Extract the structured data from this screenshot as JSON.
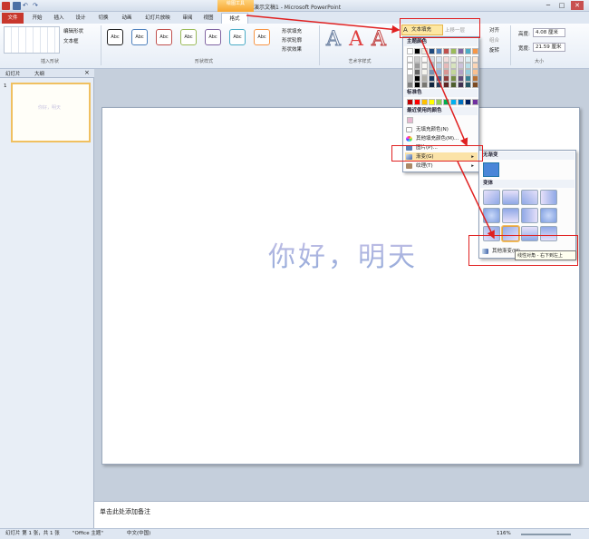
{
  "window": {
    "title": "演示文稿1 - Microsoft PowerPoint",
    "context_tab_group": "绘图工具",
    "min": "─",
    "max": "□",
    "close": "✕"
  },
  "tabs": [
    "文件",
    "开始",
    "插入",
    "设计",
    "切换",
    "动画",
    "幻灯片放映",
    "审阅",
    "视图",
    "格式"
  ],
  "ribbon": {
    "edit_shape": "编辑形状",
    "text_box": "文本框",
    "insert_shapes_group": "插入形状",
    "shape_styles_group": "形状样式",
    "shape_fill": "形状填充",
    "shape_outline": "形状轮廓",
    "shape_effects": "形状效果",
    "wordart_group": "艺术字样式",
    "text_fill": "文本填充",
    "bring_forward": "上移一层",
    "align": "对齐",
    "group": "组合",
    "rotate": "旋转",
    "height_label": "高度:",
    "height_value": "4.08 厘米",
    "width_label": "宽度:",
    "width_value": "21.59 厘米",
    "size_group": "大小",
    "abc": "Abc",
    "wordart_a": "A"
  },
  "left_panel": {
    "tab_slides": "幻灯片",
    "tab_outline": "大纲",
    "slide_number": "1",
    "thumb_text": "你好，明天"
  },
  "slide": {
    "text": "你好，明天"
  },
  "notes": {
    "placeholder": "单击此处添加备注"
  },
  "status": {
    "slide_info": "幻灯片 第 1 张，共 1 张",
    "theme": "\"Office 主题\"",
    "language": "中文(中国)",
    "zoom": "116%"
  },
  "fill_menu": {
    "theme_colors": "主题颜色",
    "standard_colors": "标准色",
    "recent_colors": "最近使用的颜色",
    "no_fill": "无填充颜色(N)",
    "more_colors": "其他填充颜色(M)...",
    "picture": "图片(P)...",
    "gradient": "渐变(G)",
    "texture": "纹理(T)"
  },
  "gradient_menu": {
    "no_gradient": "无渐变",
    "variants": "变体",
    "more_gradients": "其他渐变(M)...",
    "tooltip": "线性对角 - 右下到左上"
  },
  "colors": {
    "theme_row": [
      "#ffffff",
      "#000000",
      "#eeece1",
      "#1f497d",
      "#4f81bd",
      "#c0504d",
      "#9bbb59",
      "#8064a2",
      "#4bacc6",
      "#f79646"
    ],
    "standard": [
      "#c00000",
      "#ff0000",
      "#ffc000",
      "#ffff00",
      "#92d050",
      "#00b050",
      "#00b0f0",
      "#0070c0",
      "#002060",
      "#7030a0"
    ],
    "recent": [
      "#e6b8d0"
    ],
    "accent_red": "#e02020"
  }
}
